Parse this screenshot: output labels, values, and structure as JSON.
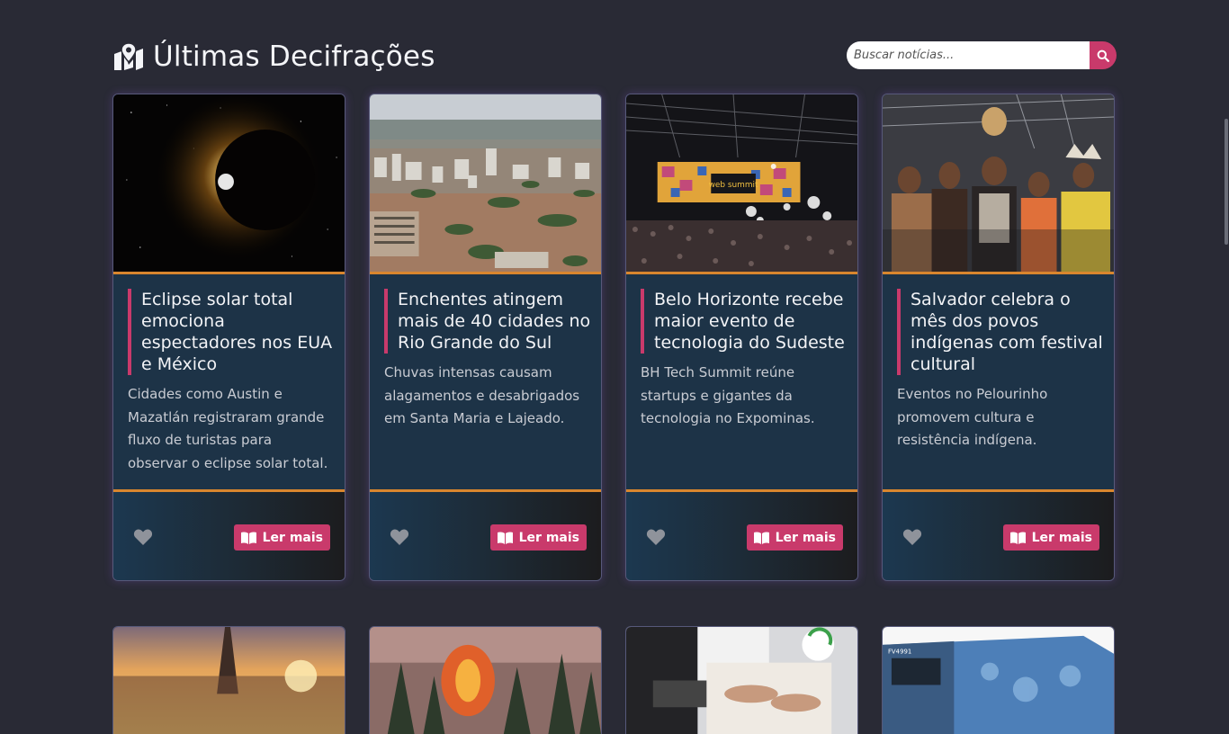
{
  "header": {
    "title": "Últimas Decifrações",
    "title_icon": "map-marked-icon",
    "search": {
      "placeholder": "Buscar notícias...",
      "value": "",
      "button_icon": "search-icon"
    }
  },
  "colors": {
    "background": "#292a35",
    "accent": "#c93a6b",
    "card_border_accent": "#d9862e",
    "card_body": "#1d3347"
  },
  "cards": [
    {
      "image": "solar-eclipse-photo",
      "title": "Eclipse solar total emociona espectadores nos EUA e México",
      "description": "Cidades como Austin e Mazatlán registraram grande fluxo de turistas para observar o eclipse solar total.",
      "like_icon": "heart-icon",
      "read_more_label": "Ler mais",
      "read_more_icon": "book-open-icon"
    },
    {
      "image": "flooded-city-photo",
      "title": "Enchentes atingem mais de 40 cidades no Rio Grande do Sul",
      "description": "Chuvas intensas causam alagamentos e desabrigados em Santa Maria e Lajeado.",
      "like_icon": "heart-icon",
      "read_more_label": "Ler mais",
      "read_more_icon": "book-open-icon"
    },
    {
      "image": "tech-event-stage-photo",
      "title": "Belo Horizonte recebe maior evento de tecnologia do Sudeste",
      "description": "BH Tech Summit reúne startups e gigantes da tecnologia no Expominas.",
      "like_icon": "heart-icon",
      "read_more_label": "Ler mais",
      "read_more_icon": "book-open-icon"
    },
    {
      "image": "indigenous-festival-photo",
      "title": "Salvador celebra o mês dos povos indígenas com festival cultural",
      "description": "Eventos no Pelourinho promovem cultura e resistência indígena.",
      "like_icon": "heart-icon",
      "read_more_label": "Ler mais",
      "read_more_icon": "book-open-icon"
    }
  ],
  "partial_cards": [
    {
      "image": "eiffel-tower-sunset-photo"
    },
    {
      "image": "forest-fire-photo"
    },
    {
      "image": "computer-operators-photo"
    },
    {
      "image": "train-photo"
    }
  ]
}
